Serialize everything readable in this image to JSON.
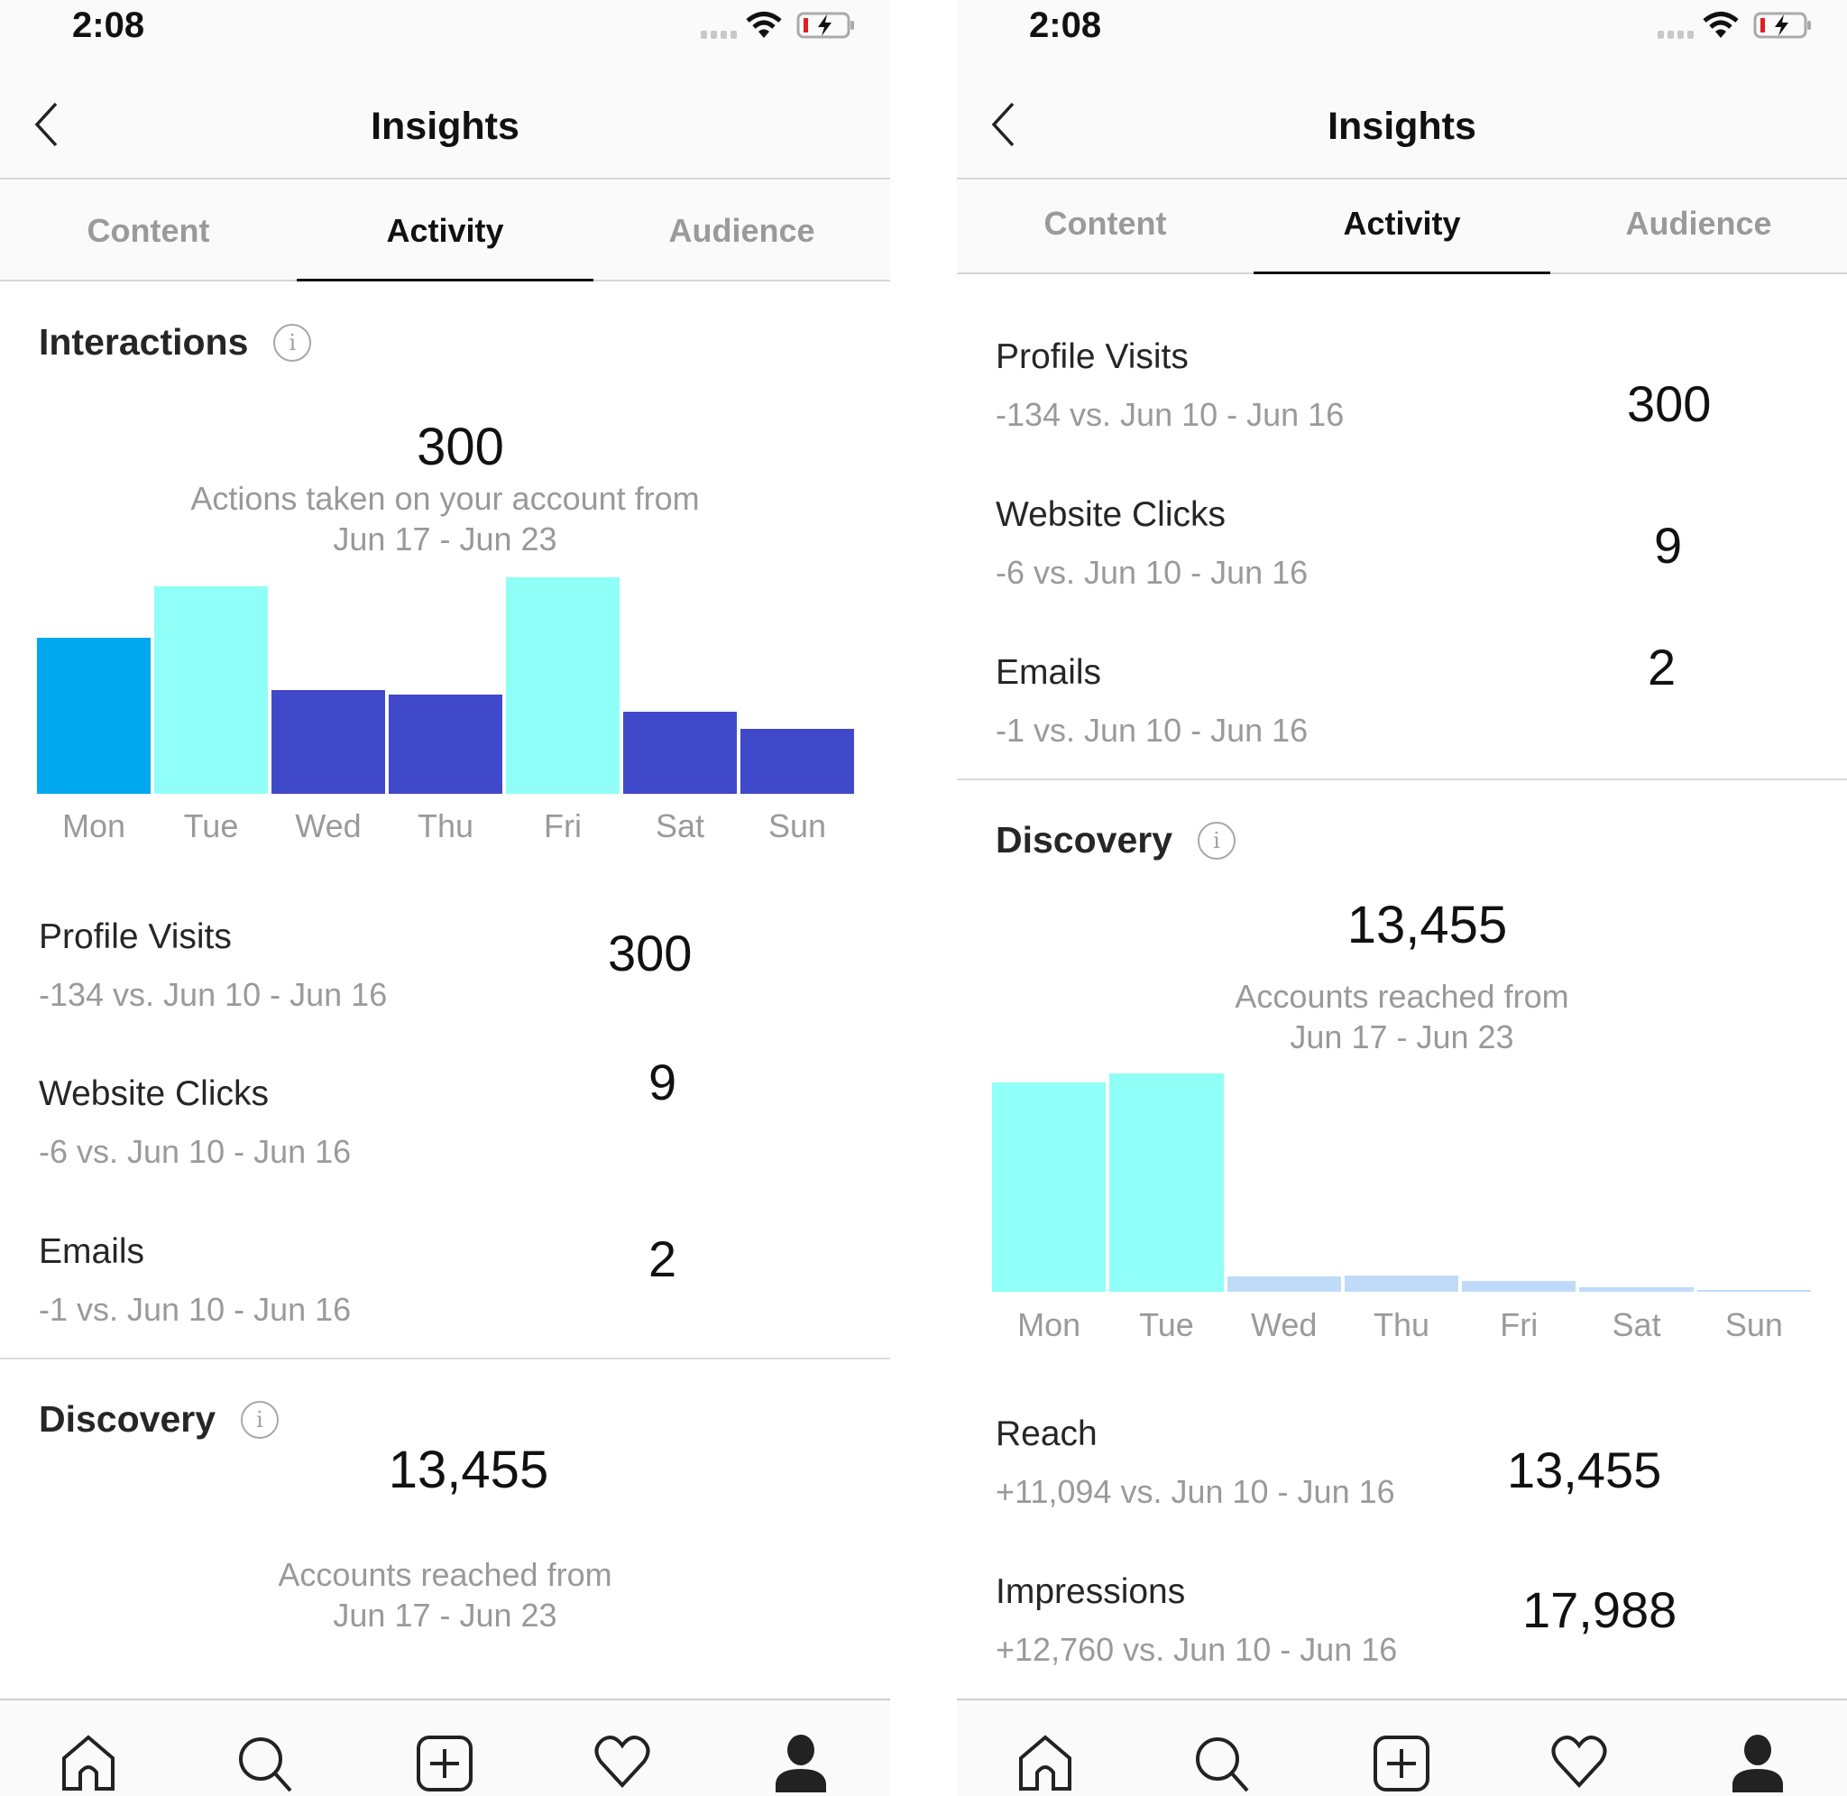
{
  "colors": {
    "bar_highlight": "#00a8f0",
    "bar_peak": "#8ffff7",
    "bar_normal": "#4049c9",
    "bar_low": "#bfdbf9",
    "text_primary": "#262626",
    "text_secondary": "#9a9a9a"
  },
  "screens": [
    {
      "status_bar": {
        "time": "2:08",
        "icons": [
          "signal-icon",
          "wifi-icon",
          "battery-charging-icon"
        ]
      },
      "header": {
        "title": "Insights",
        "back_icon": "chevron-left-icon"
      },
      "tabs": [
        {
          "label": "Content",
          "active": false
        },
        {
          "label": "Activity",
          "active": true
        },
        {
          "label": "Audience",
          "active": false
        }
      ],
      "interactions": {
        "title": "Interactions",
        "total": "300",
        "subtitle_line1": "Actions taken on your account from",
        "subtitle_line2": "Jun 17 - Jun 23"
      },
      "stats": [
        {
          "label": "Profile Visits",
          "delta": "-134 vs. Jun 10 - Jun 16",
          "value": "300"
        },
        {
          "label": "Website Clicks",
          "delta": "-6 vs. Jun 10 - Jun 16",
          "value": "9"
        },
        {
          "label": "Emails",
          "delta": "-1 vs. Jun 10 - Jun 16",
          "value": "2"
        }
      ],
      "discovery": {
        "title": "Discovery",
        "total": "13,455",
        "subtitle_line1": "Accounts reached from",
        "subtitle_line2": "Jun 17 - Jun 23"
      },
      "bottom_nav": [
        "home-icon",
        "search-icon",
        "new-post-icon",
        "activity-heart-icon",
        "profile-icon"
      ]
    },
    {
      "status_bar": {
        "time": "2:08",
        "icons": [
          "signal-icon",
          "wifi-icon",
          "battery-charging-icon"
        ]
      },
      "header": {
        "title": "Insights",
        "back_icon": "chevron-left-icon"
      },
      "tabs": [
        {
          "label": "Content",
          "active": false
        },
        {
          "label": "Activity",
          "active": true
        },
        {
          "label": "Audience",
          "active": false
        }
      ],
      "stats": [
        {
          "label": "Profile Visits",
          "delta": "-134 vs. Jun 10 - Jun 16",
          "value": "300"
        },
        {
          "label": "Website Clicks",
          "delta": "-6 vs. Jun 10 - Jun 16",
          "value": "9"
        },
        {
          "label": "Emails",
          "delta": "-1 vs. Jun 10 - Jun 16",
          "value": "2"
        }
      ],
      "discovery": {
        "title": "Discovery",
        "total": "13,455",
        "subtitle_line1": "Accounts reached from",
        "subtitle_line2": "Jun 17 - Jun 23"
      },
      "discovery_stats": [
        {
          "label": "Reach",
          "delta": "+11,094 vs. Jun 10 - Jun 16",
          "value": "13,455"
        },
        {
          "label": "Impressions",
          "delta": "+12,760 vs. Jun 10 - Jun 16",
          "value": "17,988"
        }
      ],
      "bottom_nav": [
        "home-icon",
        "search-icon",
        "new-post-icon",
        "activity-heart-icon",
        "profile-icon"
      ]
    }
  ],
  "chart_data": [
    {
      "type": "bar",
      "title": "Interactions",
      "categories": [
        "Mon",
        "Tue",
        "Wed",
        "Thu",
        "Fri",
        "Sat",
        "Sun"
      ],
      "values": [
        72,
        96,
        48,
        46,
        100,
        38,
        30
      ],
      "value_scale": "relative (percent of max bar; no axis shown)",
      "bar_colors": [
        "#00a8f0",
        "#8ffff7",
        "#4049c9",
        "#4049c9",
        "#8ffff7",
        "#4049c9",
        "#4049c9"
      ],
      "xlabel": "",
      "ylabel": "",
      "grid": false,
      "legend": "none"
    },
    {
      "type": "bar",
      "title": "Discovery",
      "categories": [
        "Mon",
        "Tue",
        "Wed",
        "Thu",
        "Fri",
        "Sat",
        "Sun"
      ],
      "values": [
        96,
        100,
        7,
        7.5,
        5,
        2,
        1
      ],
      "value_scale": "relative (percent of max bar; no axis shown)",
      "bar_colors": [
        "#8ffff7",
        "#8ffff7",
        "#bfdbf9",
        "#bfdbf9",
        "#bfdbf9",
        "#bfdbf9",
        "#bfdbf9"
      ],
      "xlabel": "",
      "ylabel": "",
      "grid": false,
      "legend": "none"
    }
  ]
}
